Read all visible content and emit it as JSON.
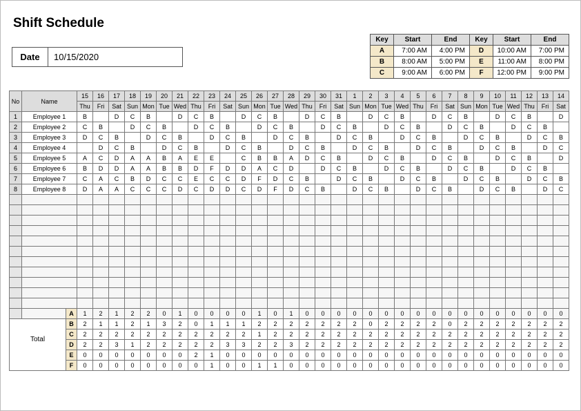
{
  "title": "Shift Schedule",
  "date_label": "Date",
  "date_value": "10/15/2020",
  "key_headers": [
    "Key",
    "Start",
    "End",
    "Key",
    "Start",
    "End"
  ],
  "key_rows": [
    [
      "A",
      "7:00 AM",
      "4:00 PM",
      "D",
      "10:00 AM",
      "7:00 PM"
    ],
    [
      "B",
      "8:00 AM",
      "5:00 PM",
      "E",
      "11:00 AM",
      "8:00 PM"
    ],
    [
      "C",
      "9:00 AM",
      "6:00 PM",
      "F",
      "12:00 PM",
      "9:00 PM"
    ]
  ],
  "sched_headers": {
    "no": "No",
    "name": "Name",
    "days_num": [
      "15",
      "16",
      "17",
      "18",
      "19",
      "20",
      "21",
      "22",
      "23",
      "24",
      "25",
      "26",
      "27",
      "28",
      "29",
      "30",
      "31",
      "1",
      "2",
      "3",
      "4",
      "5",
      "6",
      "7",
      "8",
      "9",
      "10",
      "11",
      "12",
      "13",
      "14"
    ],
    "days_week": [
      "Thu",
      "Fri",
      "Sat",
      "Sun",
      "Mon",
      "Tue",
      "Wed",
      "Thu",
      "Fri",
      "Sat",
      "Sun",
      "Mon",
      "Tue",
      "Wed",
      "Thu",
      "Fri",
      "Sat",
      "Sun",
      "Mon",
      "Tue",
      "Wed",
      "Thu",
      "Fri",
      "Sat",
      "Sun",
      "Mon",
      "Tue",
      "Wed",
      "Thu",
      "Fri",
      "Sat"
    ]
  },
  "employees": [
    {
      "no": "1",
      "name": "Employee 1",
      "shifts": [
        "B",
        "",
        "D",
        "C",
        "B",
        "",
        "D",
        "C",
        "B",
        "",
        "D",
        "C",
        "B",
        "",
        "D",
        "C",
        "B",
        "",
        "D",
        "C",
        "B",
        "",
        "D",
        "C",
        "B",
        "",
        "D",
        "C",
        "B",
        "",
        "D"
      ]
    },
    {
      "no": "2",
      "name": "Employee 2",
      "shifts": [
        "C",
        "B",
        "",
        "D",
        "C",
        "B",
        "",
        "D",
        "C",
        "B",
        "",
        "D",
        "C",
        "B",
        "",
        "D",
        "C",
        "B",
        "",
        "D",
        "C",
        "B",
        "",
        "D",
        "C",
        "B",
        "",
        "D",
        "C",
        "B",
        ""
      ]
    },
    {
      "no": "3",
      "name": "Employee 3",
      "shifts": [
        "D",
        "C",
        "B",
        "",
        "D",
        "C",
        "B",
        "",
        "D",
        "C",
        "B",
        "",
        "D",
        "C",
        "B",
        "",
        "D",
        "C",
        "B",
        "",
        "D",
        "C",
        "B",
        "",
        "D",
        "C",
        "B",
        "",
        "D",
        "C",
        "B"
      ]
    },
    {
      "no": "4",
      "name": "Employee 4",
      "shifts": [
        "",
        "D",
        "C",
        "B",
        "",
        "D",
        "C",
        "B",
        "",
        "D",
        "C",
        "B",
        "",
        "D",
        "C",
        "B",
        "",
        "D",
        "C",
        "B",
        "",
        "D",
        "C",
        "B",
        "",
        "D",
        "C",
        "B",
        "",
        "D",
        "C"
      ]
    },
    {
      "no": "5",
      "name": "Employee 5",
      "shifts": [
        "A",
        "C",
        "D",
        "A",
        "A",
        "B",
        "A",
        "E",
        "E",
        "",
        "C",
        "B",
        "B",
        "A",
        "D",
        "C",
        "B",
        "",
        "D",
        "C",
        "B",
        "",
        "D",
        "C",
        "B",
        "",
        "D",
        "C",
        "B",
        "",
        "D"
      ]
    },
    {
      "no": "6",
      "name": "Employee 6",
      "shifts": [
        "B",
        "D",
        "D",
        "A",
        "A",
        "B",
        "B",
        "D",
        "F",
        "D",
        "D",
        "A",
        "C",
        "D",
        "",
        "D",
        "C",
        "B",
        "",
        "D",
        "C",
        "B",
        "",
        "D",
        "C",
        "B",
        "",
        "D",
        "C",
        "B",
        ""
      ]
    },
    {
      "no": "7",
      "name": "Employee 7",
      "shifts": [
        "C",
        "A",
        "C",
        "B",
        "D",
        "C",
        "C",
        "E",
        "C",
        "C",
        "D",
        "F",
        "D",
        "C",
        "B",
        "",
        "D",
        "C",
        "B",
        "",
        "D",
        "C",
        "B",
        "",
        "D",
        "C",
        "B",
        "",
        "D",
        "C",
        "B"
      ]
    },
    {
      "no": "8",
      "name": "Employee 8",
      "shifts": [
        "D",
        "A",
        "A",
        "C",
        "C",
        "C",
        "D",
        "C",
        "D",
        "D",
        "C",
        "D",
        "F",
        "D",
        "C",
        "B",
        "",
        "D",
        "C",
        "B",
        "",
        "D",
        "C",
        "B",
        "",
        "D",
        "C",
        "B",
        "",
        "D",
        "C"
      ]
    }
  ],
  "blank_rows": 12,
  "total_label": "Total",
  "total_keys": [
    "A",
    "B",
    "C",
    "D",
    "E",
    "F"
  ],
  "total_matrix": [
    [
      "1",
      "2",
      "1",
      "2",
      "2",
      "0",
      "1",
      "0",
      "0",
      "0",
      "0",
      "1",
      "0",
      "1",
      "0",
      "0",
      "0",
      "0",
      "0",
      "0",
      "0",
      "0",
      "0",
      "0",
      "0",
      "0",
      "0",
      "0",
      "0",
      "0",
      "0"
    ],
    [
      "2",
      "1",
      "1",
      "2",
      "1",
      "3",
      "2",
      "0",
      "1",
      "1",
      "1",
      "2",
      "2",
      "2",
      "2",
      "2",
      "2",
      "2",
      "0",
      "2",
      "2",
      "2",
      "2",
      "0",
      "2",
      "2",
      "2",
      "2",
      "2",
      "2",
      "2"
    ],
    [
      "2",
      "2",
      "2",
      "2",
      "2",
      "2",
      "2",
      "2",
      "2",
      "2",
      "2",
      "1",
      "2",
      "2",
      "2",
      "2",
      "2",
      "2",
      "2",
      "2",
      "2",
      "2",
      "2",
      "2",
      "2",
      "2",
      "2",
      "2",
      "2",
      "2",
      "2"
    ],
    [
      "2",
      "2",
      "3",
      "1",
      "2",
      "2",
      "2",
      "2",
      "2",
      "3",
      "3",
      "2",
      "2",
      "3",
      "2",
      "2",
      "2",
      "2",
      "2",
      "2",
      "2",
      "2",
      "2",
      "2",
      "2",
      "2",
      "2",
      "2",
      "2",
      "2",
      "2"
    ],
    [
      "0",
      "0",
      "0",
      "0",
      "0",
      "0",
      "0",
      "2",
      "1",
      "0",
      "0",
      "0",
      "0",
      "0",
      "0",
      "0",
      "0",
      "0",
      "0",
      "0",
      "0",
      "0",
      "0",
      "0",
      "0",
      "0",
      "0",
      "0",
      "0",
      "0",
      "0"
    ],
    [
      "0",
      "0",
      "0",
      "0",
      "0",
      "0",
      "0",
      "0",
      "1",
      "0",
      "0",
      "1",
      "1",
      "0",
      "0",
      "0",
      "0",
      "0",
      "0",
      "0",
      "0",
      "0",
      "0",
      "0",
      "0",
      "0",
      "0",
      "0",
      "0",
      "0",
      "0"
    ]
  ]
}
